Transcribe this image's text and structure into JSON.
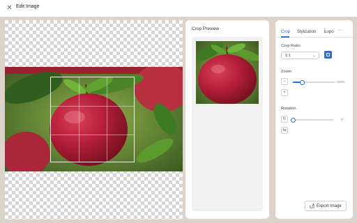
{
  "app": {
    "title": "Edit Image"
  },
  "preview": {
    "title": "Crop Preview"
  },
  "tabs": [
    {
      "label": "Crop",
      "active": true
    },
    {
      "label": "Stylization",
      "active": false
    },
    {
      "label": "Expor",
      "active": false
    }
  ],
  "crop": {
    "ratio_label": "Crop Ratio",
    "ratio_value": "1:1",
    "zoom_label": "Zoom",
    "zoom_value": "100%",
    "zoom_fraction": 0.22,
    "rotation_label": "Rotation",
    "rotation_value": "0°",
    "rotation_fraction": 0.0
  },
  "actions": {
    "export_label": "Export Image"
  },
  "colors": {
    "accent": "#2a6fd6",
    "workspace": "#dcd3cb"
  },
  "icons": [
    "close-icon",
    "chevron-down-icon",
    "aspect-square-icon",
    "zoom-out-icon",
    "zoom-in-icon",
    "rotate-right-icon",
    "flip-icon",
    "export-icon",
    "more-icon"
  ]
}
